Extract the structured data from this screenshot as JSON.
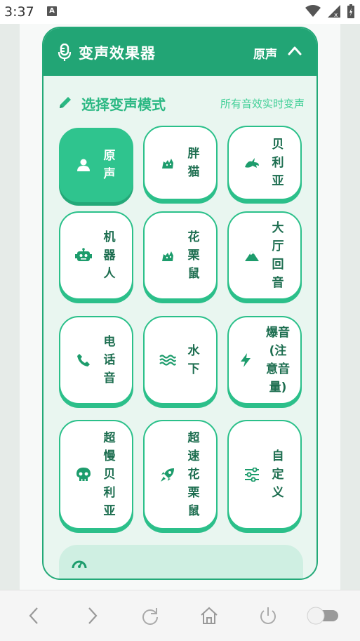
{
  "status_bar": {
    "time": "3:37",
    "notification_letter": "A"
  },
  "header": {
    "title": "变声效果器",
    "current_mode": "原声"
  },
  "section": {
    "title": "选择变声模式",
    "hint": "所有音效实时变声"
  },
  "modes": [
    {
      "label": "原声",
      "icon": "person-icon",
      "active": true
    },
    {
      "label": "胖猫",
      "icon": "cat-icon",
      "active": false
    },
    {
      "label": "贝利亚",
      "icon": "dragon-icon",
      "active": false
    },
    {
      "label": "机器人",
      "icon": "robot-icon",
      "active": false
    },
    {
      "label": "花栗鼠",
      "icon": "cat-icon",
      "active": false
    },
    {
      "label": "大厅回音",
      "icon": "mountain-icon",
      "active": false
    },
    {
      "label": "电话音",
      "icon": "phone-icon",
      "active": false
    },
    {
      "label": "水下",
      "icon": "water-icon",
      "active": false
    },
    {
      "label": "爆音(注意音量)",
      "icon": "bolt-icon",
      "active": false
    },
    {
      "label": "超慢贝利亚",
      "icon": "skull-icon",
      "active": false
    },
    {
      "label": "超速花栗鼠",
      "icon": "rocket-icon",
      "active": false
    },
    {
      "label": "自定义",
      "icon": "sliders-icon",
      "active": false
    }
  ],
  "colors": {
    "accent": "#22a575",
    "accent_light": "#2fc48e",
    "panel_bg": "#e9f6f0",
    "text_dark": "#1d6e50"
  },
  "nav": {
    "items": [
      "back-icon",
      "forward-icon",
      "refresh-icon",
      "home-icon",
      "power-icon",
      "toggle-switch"
    ]
  }
}
